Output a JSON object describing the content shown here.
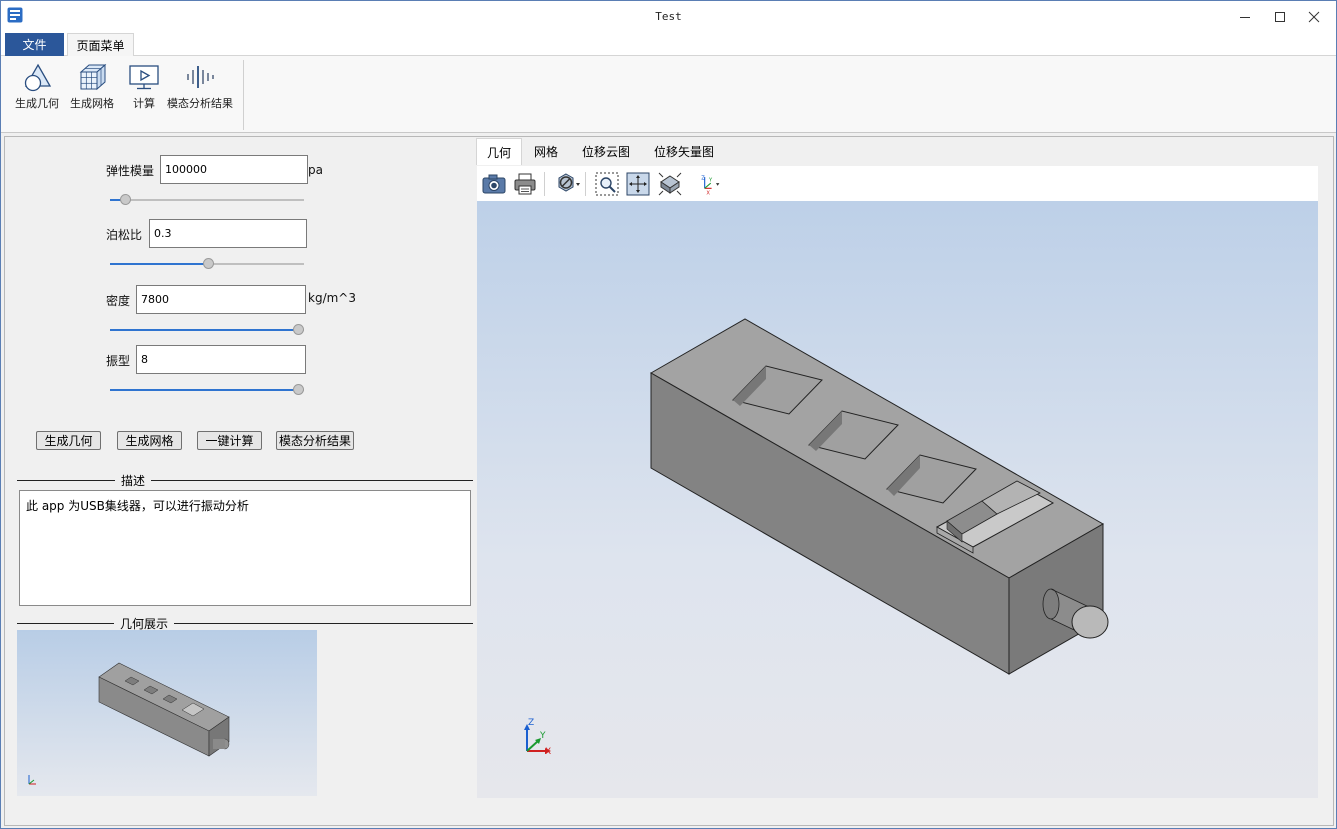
{
  "window": {
    "title": "Test"
  },
  "ribbon": {
    "tabs": [
      {
        "label": "文件"
      },
      {
        "label": "页面菜单"
      }
    ],
    "buttons": [
      {
        "label": "生成几何",
        "icon": "geometry-icon"
      },
      {
        "label": "生成网格",
        "icon": "mesh-icon"
      },
      {
        "label": "计算",
        "icon": "compute-icon"
      },
      {
        "label": "模态分析结果",
        "icon": "modal-result-icon"
      }
    ]
  },
  "params": {
    "elastic_modulus": {
      "label": "弹性模量",
      "value": "100000",
      "unit": "pa",
      "slider_fraction": 0.08
    },
    "poisson": {
      "label": "泊松比",
      "value": "0.3",
      "slider_fraction": 0.5
    },
    "density": {
      "label": "密度",
      "value": "7800",
      "unit": "kg/m^3",
      "slider_fraction": 1.0
    },
    "mode": {
      "label": "振型",
      "value": "8",
      "slider_fraction": 1.0
    }
  },
  "actions": {
    "gen_geometry": "生成几何",
    "gen_mesh": "生成网格",
    "one_click_compute": "一键计算",
    "modal_result": "模态分析结果"
  },
  "description": {
    "title": "描述",
    "text": "此 app 为USB集线器，可以进行振动分析"
  },
  "geometry_preview": {
    "title": "几何展示"
  },
  "view_tabs": [
    {
      "label": "几何",
      "active": true
    },
    {
      "label": "网格",
      "active": false
    },
    {
      "label": "位移云图",
      "active": false
    },
    {
      "label": "位移矢量图",
      "active": false
    }
  ],
  "view_toolbar": [
    "camera-icon",
    "print-icon",
    "hide-icon",
    "zoom-window-icon",
    "fit-all-icon",
    "view-cube-icon",
    "axis-icon"
  ],
  "axis_triad": {
    "z": "Z",
    "y": "Y",
    "x": "X"
  },
  "colors": {
    "accent": "#2b579a",
    "slider_fill": "#2f74d0",
    "viewport_top": "#bdd0e8",
    "viewport_bottom": "#e6e7ec",
    "model": "#8a8a8a"
  }
}
